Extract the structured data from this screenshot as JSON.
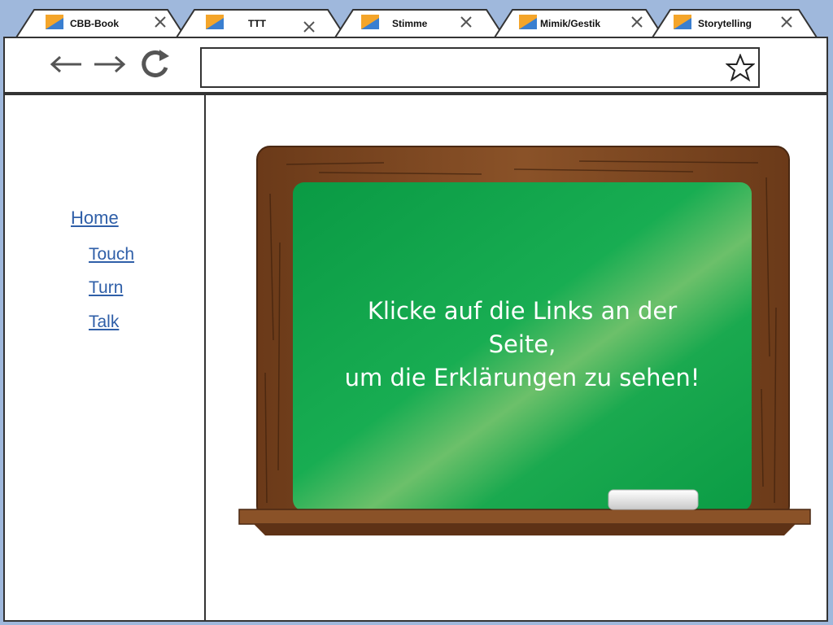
{
  "tabs": [
    {
      "label": "CBB-Book"
    },
    {
      "label": "TTT"
    },
    {
      "label": "Stimme"
    },
    {
      "label": "Mimik/Gestik"
    },
    {
      "label": "Storytelling"
    }
  ],
  "toolbar": {
    "back_icon": "arrow-left-icon",
    "forward_icon": "arrow-right-icon",
    "reload_icon": "reload-icon",
    "address_value": "",
    "bookmark_icon": "star-icon"
  },
  "sidebar": {
    "home": "Home",
    "links": [
      {
        "label": "Touch"
      },
      {
        "label": "Turn"
      },
      {
        "label": "Talk"
      }
    ]
  },
  "main": {
    "board_lines": [
      "Klicke auf die Links an der",
      "Seite,",
      "um die Erklärungen zu sehen!"
    ]
  },
  "colors": {
    "background": "#9fb8dc",
    "link": "#2f5fa8",
    "chalkboard": "#0fa24a",
    "frame": "#7a4621"
  }
}
